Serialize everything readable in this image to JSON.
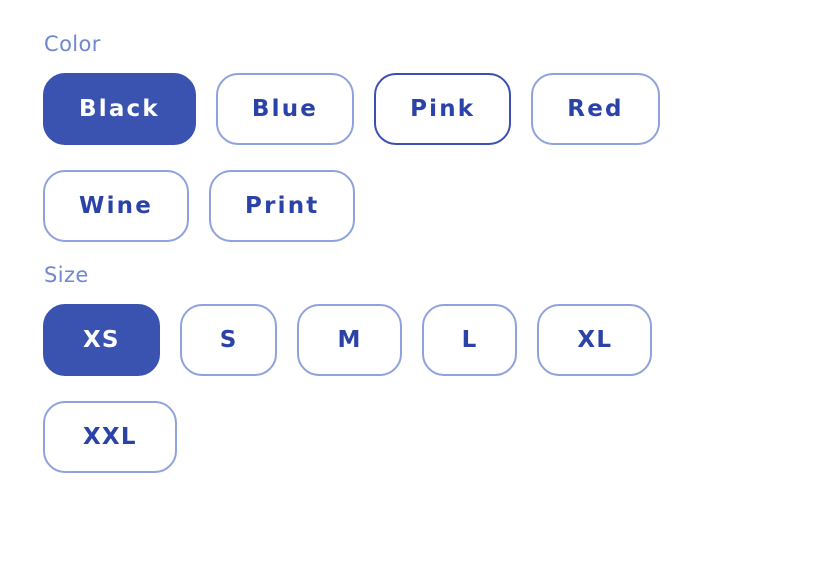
{
  "groups": [
    {
      "label": "Color",
      "options": [
        {
          "label": "Black",
          "state": "selected"
        },
        {
          "label": "Blue",
          "state": "default"
        },
        {
          "label": "Pink",
          "state": "focused"
        },
        {
          "label": "Red",
          "state": "default"
        },
        {
          "label": "Wine",
          "state": "default"
        },
        {
          "label": "Print",
          "state": "default"
        }
      ]
    },
    {
      "label": "Size",
      "options": [
        {
          "label": "XS",
          "state": "selected"
        },
        {
          "label": "S",
          "state": "default"
        },
        {
          "label": "M",
          "state": "default"
        },
        {
          "label": "L",
          "state": "default"
        },
        {
          "label": "XL",
          "state": "default"
        },
        {
          "label": "XXL",
          "state": "default"
        }
      ]
    }
  ],
  "colors": {
    "selected_fill": "#3a52b0",
    "selected_text": "#ffffff",
    "default_border": "#8fa2dd",
    "default_text": "#2b43a8",
    "focused_border": "#3b4fb5",
    "label_text": "#7187d0",
    "background": "#ffffff"
  }
}
